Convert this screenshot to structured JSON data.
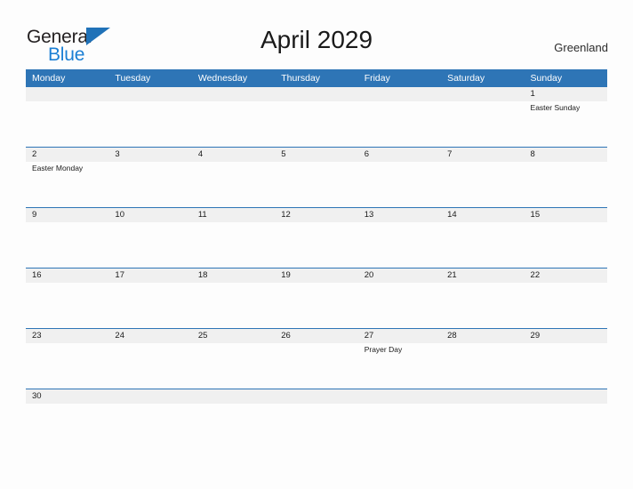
{
  "logo": {
    "word_top": "General",
    "word_bottom": "Blue",
    "flag_icon": "blue-triangle-flag-icon",
    "blue_hex": "#1b7fd4",
    "flag_hex": "#2072b8"
  },
  "header": {
    "title": "April 2029",
    "region": "Greenland"
  },
  "theme": {
    "header_blue": "#2e75b6",
    "date_band_gray": "#f0f0f0",
    "page_background": "#fdfdfd",
    "row_rule": "#2e75b6"
  },
  "calendar": {
    "month": "April",
    "year": "2029",
    "weekdays": [
      "Monday",
      "Tuesday",
      "Wednesday",
      "Thursday",
      "Friday",
      "Saturday",
      "Sunday"
    ],
    "weeks": [
      {
        "days": [
          {
            "date": "",
            "events": []
          },
          {
            "date": "",
            "events": []
          },
          {
            "date": "",
            "events": []
          },
          {
            "date": "",
            "events": []
          },
          {
            "date": "",
            "events": []
          },
          {
            "date": "",
            "events": []
          },
          {
            "date": "1",
            "events": [
              "Easter Sunday"
            ]
          }
        ]
      },
      {
        "days": [
          {
            "date": "2",
            "events": [
              "Easter Monday"
            ]
          },
          {
            "date": "3",
            "events": []
          },
          {
            "date": "4",
            "events": []
          },
          {
            "date": "5",
            "events": []
          },
          {
            "date": "6",
            "events": []
          },
          {
            "date": "7",
            "events": []
          },
          {
            "date": "8",
            "events": []
          }
        ]
      },
      {
        "days": [
          {
            "date": "9",
            "events": []
          },
          {
            "date": "10",
            "events": []
          },
          {
            "date": "11",
            "events": []
          },
          {
            "date": "12",
            "events": []
          },
          {
            "date": "13",
            "events": []
          },
          {
            "date": "14",
            "events": []
          },
          {
            "date": "15",
            "events": []
          }
        ]
      },
      {
        "days": [
          {
            "date": "16",
            "events": []
          },
          {
            "date": "17",
            "events": []
          },
          {
            "date": "18",
            "events": []
          },
          {
            "date": "19",
            "events": []
          },
          {
            "date": "20",
            "events": []
          },
          {
            "date": "21",
            "events": []
          },
          {
            "date": "22",
            "events": []
          }
        ]
      },
      {
        "days": [
          {
            "date": "23",
            "events": []
          },
          {
            "date": "24",
            "events": []
          },
          {
            "date": "25",
            "events": []
          },
          {
            "date": "26",
            "events": []
          },
          {
            "date": "27",
            "events": [
              "Prayer Day"
            ]
          },
          {
            "date": "28",
            "events": []
          },
          {
            "date": "29",
            "events": []
          }
        ]
      },
      {
        "last": true,
        "days": [
          {
            "date": "30",
            "events": []
          },
          {
            "date": "",
            "events": []
          },
          {
            "date": "",
            "events": []
          },
          {
            "date": "",
            "events": []
          },
          {
            "date": "",
            "events": []
          },
          {
            "date": "",
            "events": []
          },
          {
            "date": "",
            "events": []
          }
        ]
      }
    ]
  }
}
